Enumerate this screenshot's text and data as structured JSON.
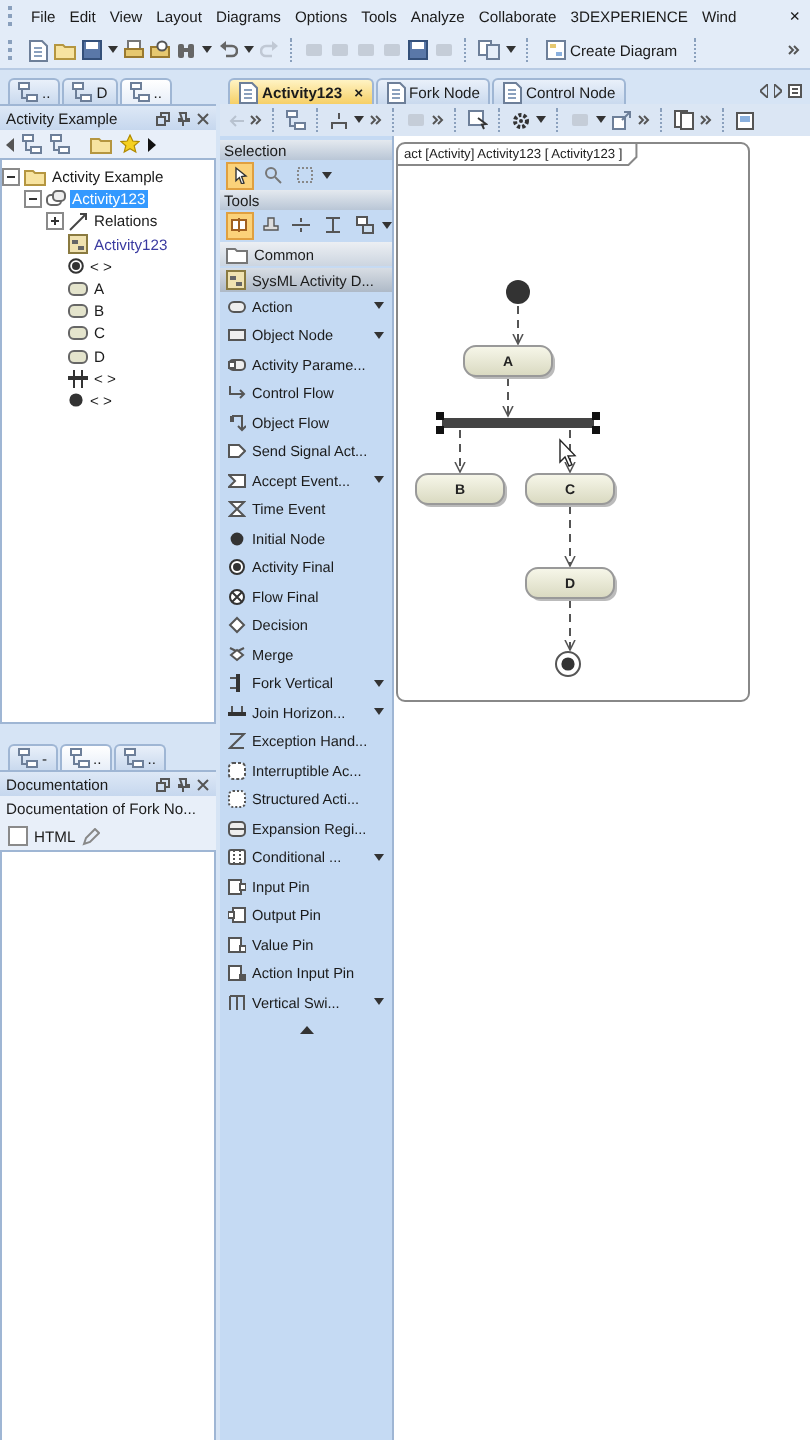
{
  "menu": {
    "items": [
      "File",
      "Edit",
      "View",
      "Layout",
      "Diagrams",
      "Options",
      "Tools",
      "Analyze",
      "Collaborate",
      "3DEXPERIENCE",
      "Wind"
    ],
    "close": "×"
  },
  "toolbar": {
    "button": "Create Diagram"
  },
  "left_tabs": [
    {
      "label": "..",
      "selected": false
    },
    {
      "label": "D",
      "selected": false
    },
    {
      "label": "..",
      "selected": true
    }
  ],
  "containment": {
    "title": "Activity Example",
    "tree": [
      {
        "label": "Activity Example",
        "kind": "package",
        "expanded": true,
        "selected": false,
        "children": [
          {
            "label": "Activity123",
            "kind": "activity",
            "expanded": true,
            "selected": true,
            "children": [
              {
                "label": "Relations",
                "kind": "relations",
                "expanded": false,
                "selected": false
              },
              {
                "label": "Activity123",
                "kind": "diagram",
                "selected": false
              },
              {
                "label": "< >",
                "kind": "final",
                "selected": false
              },
              {
                "label": "A",
                "kind": "action",
                "selected": false
              },
              {
                "label": "B",
                "kind": "action",
                "selected": false
              },
              {
                "label": "C",
                "kind": "action",
                "selected": false
              },
              {
                "label": "D",
                "kind": "action",
                "selected": false
              },
              {
                "label": "< >",
                "kind": "fork",
                "selected": false
              },
              {
                "label": "< >",
                "kind": "initial",
                "selected": false
              }
            ]
          }
        ]
      }
    ]
  },
  "doc_tabs": [
    {
      "label": "-",
      "selected": false
    },
    {
      "label": "..",
      "selected": true
    },
    {
      "label": "..",
      "selected": false
    }
  ],
  "documentation": {
    "title": "Documentation",
    "text": "Documentation of Fork No...",
    "html": {
      "label": "HTML",
      "checked": false
    }
  },
  "editor_tabs": [
    {
      "label": "Activity123",
      "selected": true,
      "close": "×"
    },
    {
      "label": "Fork Node",
      "selected": false
    },
    {
      "label": "Control Node",
      "selected": false
    }
  ],
  "palette": {
    "selection": {
      "title": "Selection",
      "tools": [
        {
          "selected": true
        },
        {
          "selected": false
        },
        {
          "selected": false
        }
      ]
    },
    "tools": {
      "title": "Tools",
      "tools": [
        {
          "selected": true
        },
        {
          "selected": false
        },
        {
          "selected": false
        },
        {
          "selected": false
        },
        {
          "selected": false
        }
      ]
    },
    "groups": [
      {
        "label": "Common",
        "expanded": false
      },
      {
        "label": "SysML Activity D...",
        "expanded": true
      }
    ],
    "items": [
      {
        "label": "Action",
        "dropdown": true
      },
      {
        "label": "Object Node",
        "dropdown": true
      },
      {
        "label": "Activity Parame...",
        "dropdown": false
      },
      {
        "label": "Control Flow",
        "dropdown": false
      },
      {
        "label": "Object Flow",
        "dropdown": false
      },
      {
        "label": "Send Signal Act...",
        "dropdown": false
      },
      {
        "label": "Accept Event...",
        "dropdown": true
      },
      {
        "label": "Time Event",
        "dropdown": false
      },
      {
        "label": "Initial Node",
        "dropdown": false
      },
      {
        "label": "Activity Final",
        "dropdown": false
      },
      {
        "label": "Flow Final",
        "dropdown": false
      },
      {
        "label": "Decision",
        "dropdown": false
      },
      {
        "label": "Merge",
        "dropdown": false
      },
      {
        "label": "Fork Vertical",
        "dropdown": true
      },
      {
        "label": "Join Horizon...",
        "dropdown": true
      },
      {
        "label": "Exception Hand...",
        "dropdown": false
      },
      {
        "label": "Interruptible Ac...",
        "dropdown": false
      },
      {
        "label": "Structured Acti...",
        "dropdown": false
      },
      {
        "label": "Expansion Regi...",
        "dropdown": false
      },
      {
        "label": "Conditional ...",
        "dropdown": true
      },
      {
        "label": "Input Pin",
        "dropdown": false
      },
      {
        "label": "Output Pin",
        "dropdown": false
      },
      {
        "label": "Value Pin",
        "dropdown": false
      },
      {
        "label": "Action Input Pin",
        "dropdown": false
      },
      {
        "label": "Vertical Swi...",
        "dropdown": true
      }
    ]
  },
  "diagram": {
    "frame_label": "act [Activity] Activity123 [ Activity123 ]",
    "nodes": [
      {
        "kind": "initial",
        "selected": false
      },
      {
        "kind": "action",
        "label": "A",
        "selected": false
      },
      {
        "kind": "fork",
        "selected": true
      },
      {
        "kind": "action",
        "label": "B",
        "selected": false
      },
      {
        "kind": "action",
        "label": "C",
        "selected": false
      },
      {
        "kind": "action",
        "label": "D",
        "selected": false
      },
      {
        "kind": "final",
        "selected": false
      }
    ]
  }
}
